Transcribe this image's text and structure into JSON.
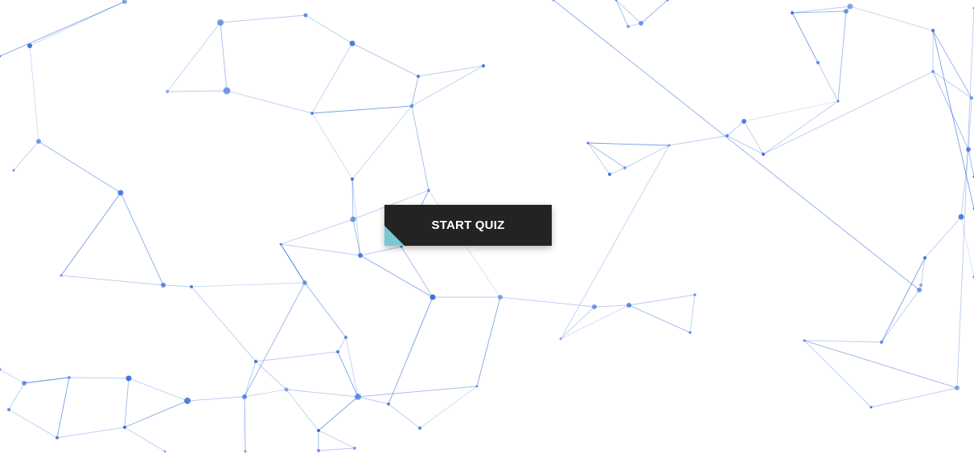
{
  "page": {
    "background_color": "#ffffff"
  },
  "background_network": {
    "description_icon": "network-mesh-icon",
    "line_color": "#2e6ad8",
    "node_color": "#2e6ad8"
  },
  "start_button": {
    "label": "START QUIZ",
    "background_color": "#232323",
    "text_color": "#ffffff",
    "fold_color": "#78c8d4"
  }
}
